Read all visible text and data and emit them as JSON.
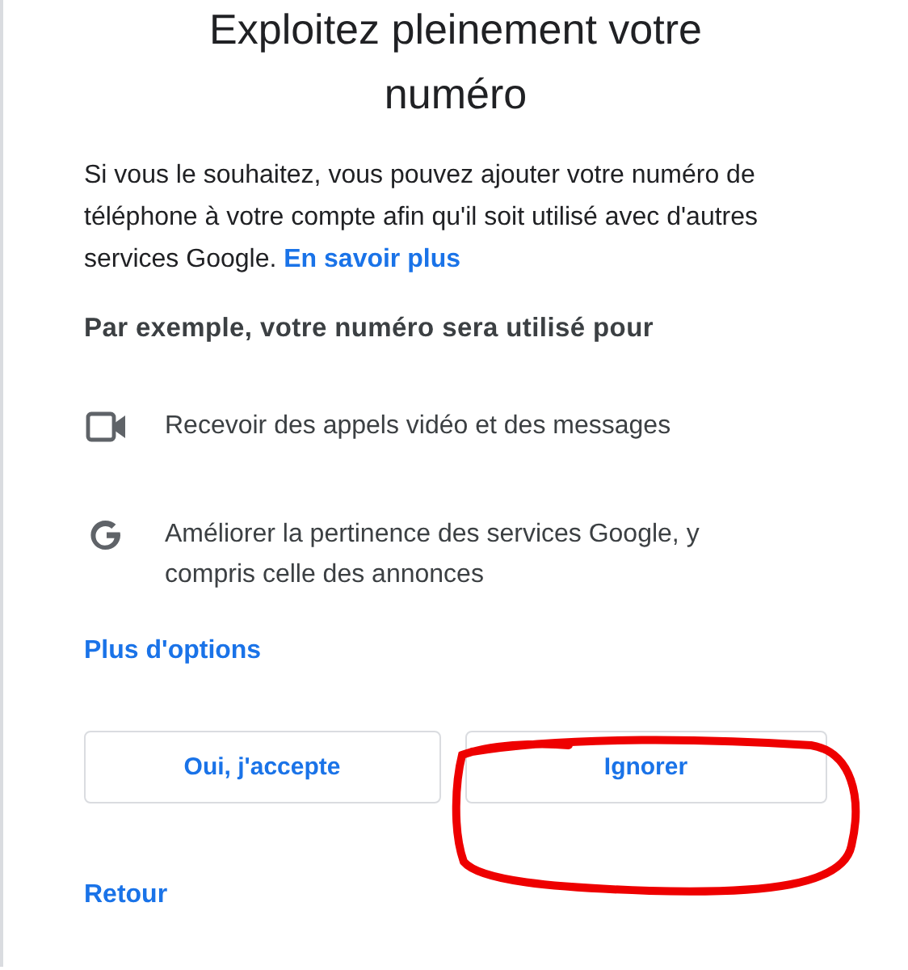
{
  "title": "Exploitez pleinement votre numéro",
  "intro": {
    "text": "Si vous le souhaitez, vous pouvez ajouter votre numéro de téléphone à votre compte afin qu'il soit utilisé avec d'autres services Google.",
    "link": "En savoir plus"
  },
  "subheading": "Par exemple, votre numéro sera utilisé pour",
  "uses": [
    {
      "kind": "video",
      "text": "Recevoir des appels vidéo et des messages"
    },
    {
      "kind": "google",
      "text": "Améliorer la pertinence des services Google, y compris celle des annonces"
    }
  ],
  "more_options": "Plus d'options",
  "buttons": [
    "Oui, j'accepte",
    "Ignorer"
  ],
  "back": "Retour"
}
